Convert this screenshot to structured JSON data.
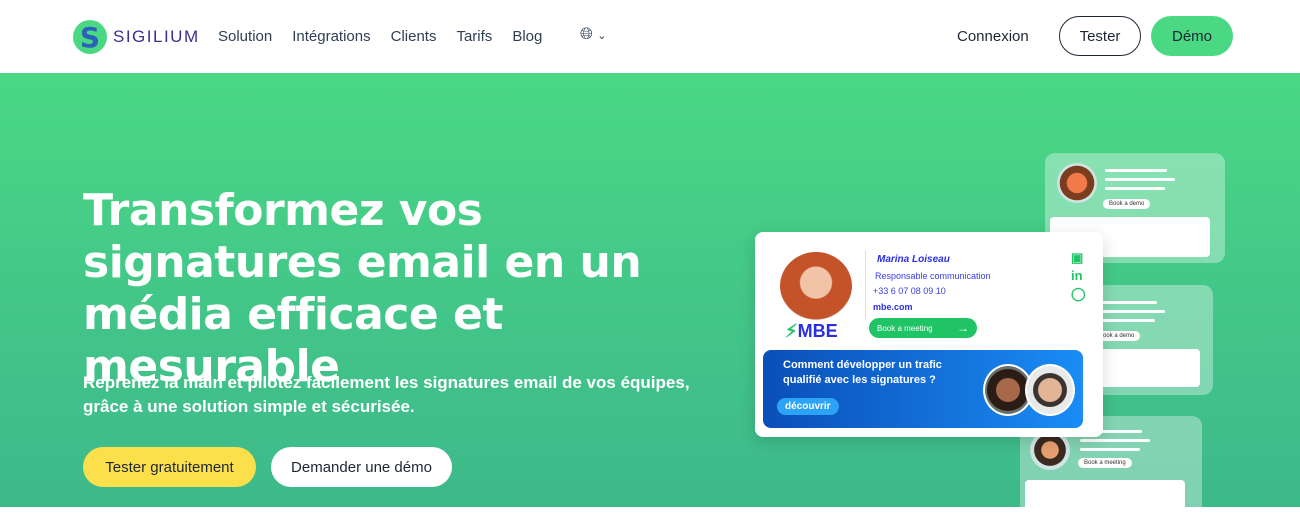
{
  "nav": {
    "brand": "SIGILIUM",
    "logo_letter": "S",
    "items": [
      {
        "label": "Solution"
      },
      {
        "label": "Intégrations"
      },
      {
        "label": "Clients"
      },
      {
        "label": "Tarifs"
      },
      {
        "label": "Blog"
      }
    ],
    "language_icon": "globe-icon",
    "login": "Connexion",
    "tester": "Tester",
    "demo": "Démo"
  },
  "hero": {
    "title": "Transformez vos signatures email en un média efficace et mesurable",
    "subtitle": "Reprenez la main et pilotez facilement les signatures email de vos équipes, grâce à une solution simple et sécurisée.",
    "cta_primary": "Tester gratuitement",
    "cta_secondary": "Demander une démo"
  },
  "illustration": {
    "name": "Marina Loiseau",
    "role": "Responsable communication",
    "phone": "+33 6 07 08 09 10",
    "website": "mbe.com",
    "company": "MBE",
    "book_meeting": "Book a meeting",
    "banner_text": "Comment développer un trafic qualifié avec les signatures ?",
    "banner_cta": "découvrir",
    "mini_cta_1": "Book a demo",
    "mini_cta_2": "Book a demo",
    "mini_cta_3": "Book a meeting"
  },
  "colors": {
    "accent": "#4bd883",
    "cta_yellow": "#fbe04b",
    "signature_blue": "#2a2ee0"
  }
}
